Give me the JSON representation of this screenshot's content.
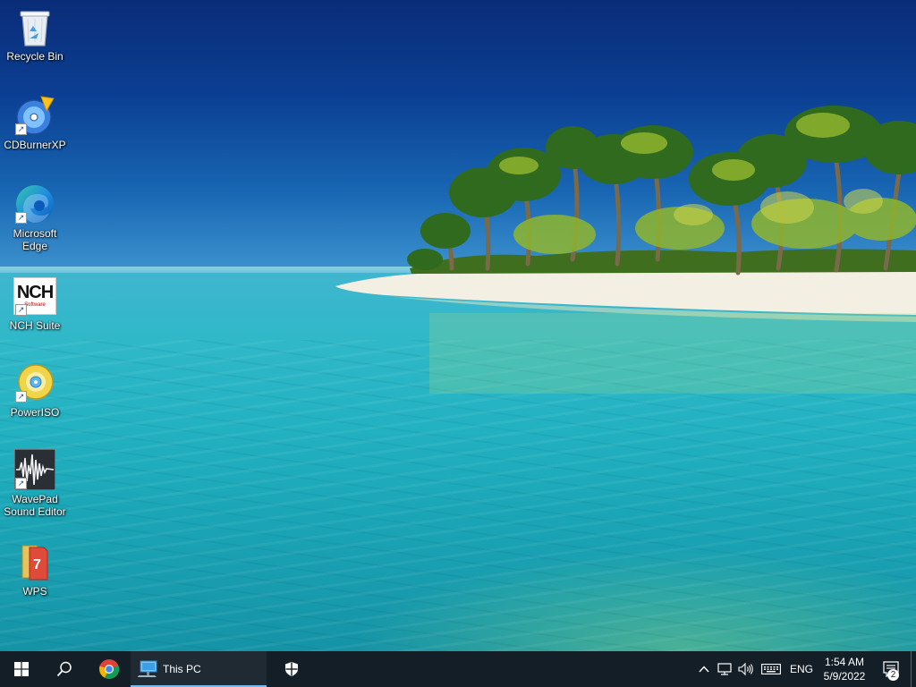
{
  "desktop": {
    "icons": [
      {
        "label": "Recycle Bin",
        "icon": "recycle-bin-icon"
      },
      {
        "label": "CDBurnerXP",
        "icon": "cdburnerxp-icon"
      },
      {
        "label": "Microsoft\nEdge",
        "icon": "edge-icon"
      },
      {
        "label": "NCH Suite",
        "icon": "nch-suite-icon"
      },
      {
        "label": "PowerISO",
        "icon": "poweriso-icon"
      },
      {
        "label": "WavePad\nSound Editor",
        "icon": "wavepad-icon"
      },
      {
        "label": "WPS",
        "icon": "wps-icon"
      }
    ],
    "nch_logo_text": "NCH",
    "nch_logo_sub": "Software"
  },
  "taskbar": {
    "running_app_label": "This PC",
    "tray": {
      "language": "ENG",
      "time": "1:54 AM",
      "date": "5/9/2022",
      "notification_count": "2"
    }
  },
  "colors": {
    "taskbar": "#141e26",
    "active_indicator": "#76b9ed",
    "windows_logo": "#ffffff"
  }
}
